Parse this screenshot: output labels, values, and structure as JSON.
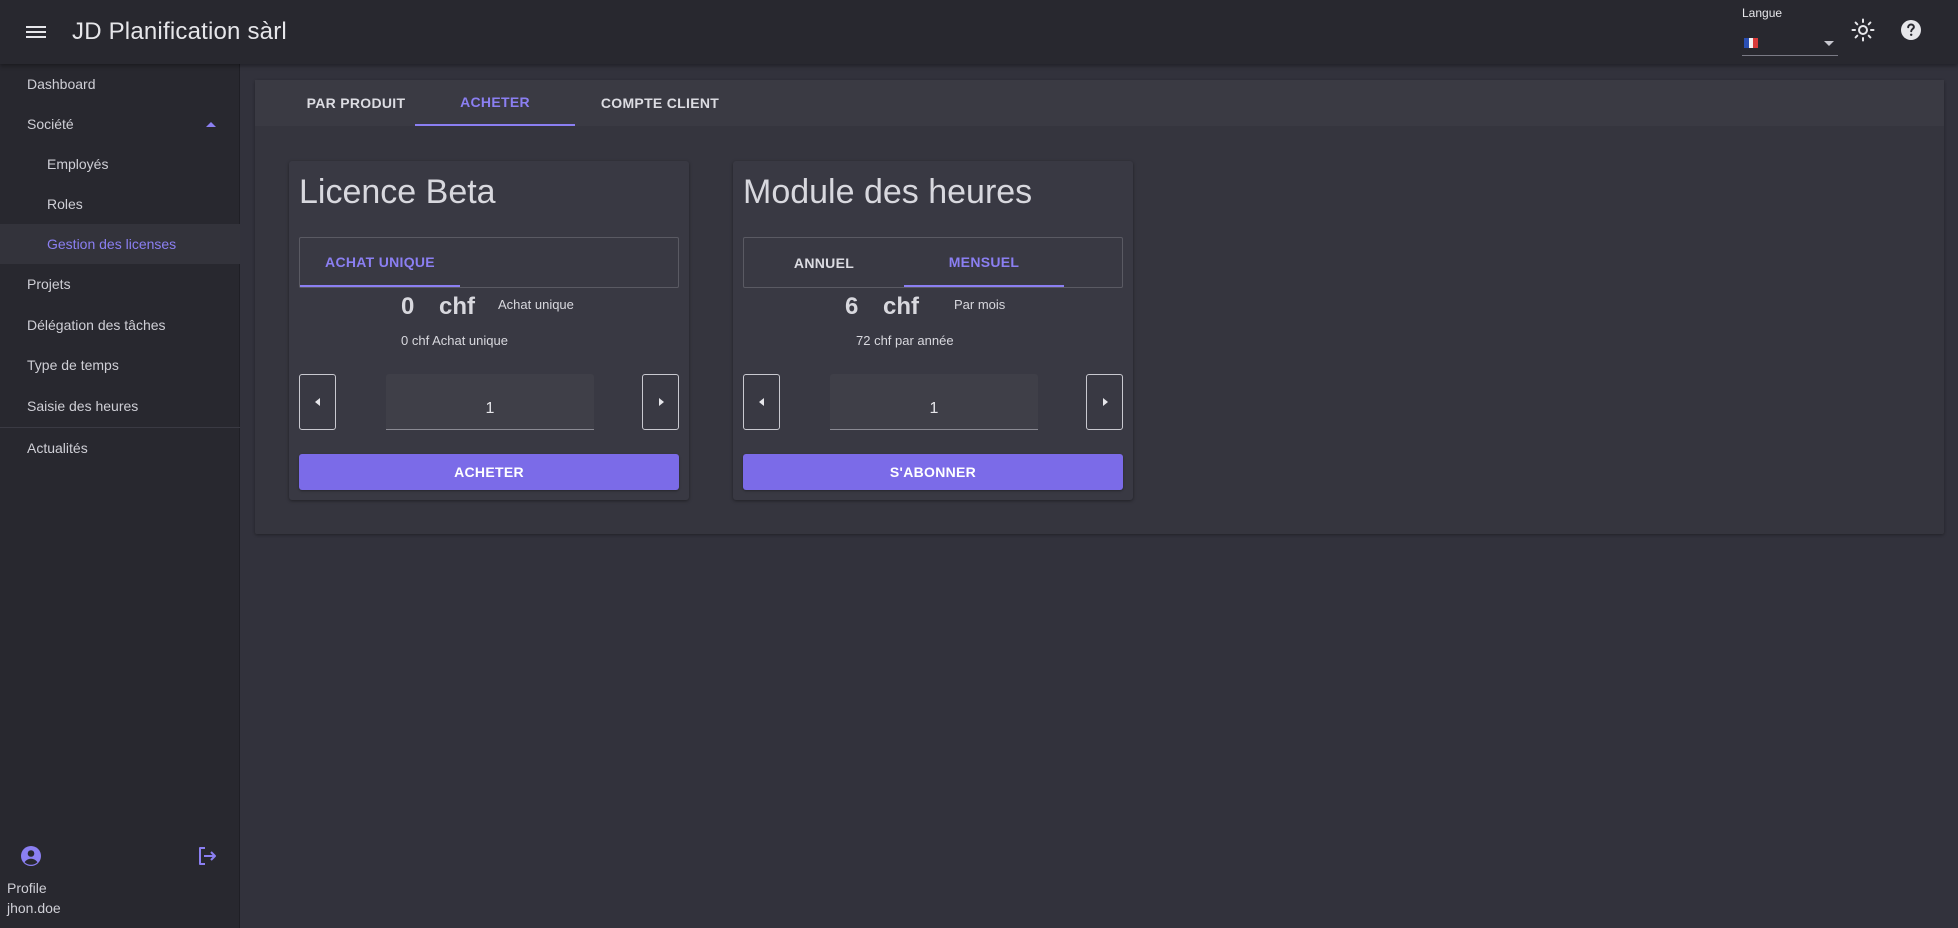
{
  "app": {
    "title": "JD Planification sàrl"
  },
  "header": {
    "language_label": "Langue",
    "language_value": "fr",
    "icons": [
      "menu-icon",
      "flag-fr-icon",
      "chevron-down-icon",
      "sun-icon",
      "help-icon"
    ]
  },
  "sidebar": {
    "items": [
      {
        "label": "Dashboard"
      },
      {
        "label": "Société"
      },
      {
        "label": "Employés"
      },
      {
        "label": "Roles"
      },
      {
        "label": "Gestion des licenses"
      },
      {
        "label": "Projets"
      },
      {
        "label": "Délégation des tâches"
      },
      {
        "label": "Type de temps"
      },
      {
        "label": "Saisie des heures"
      },
      {
        "label": "Actualités"
      }
    ],
    "profile_label": "Profile",
    "username": "jhon.doe"
  },
  "main": {
    "tabs": [
      {
        "label": "PAR PRODUIT"
      },
      {
        "label": "ACHETER"
      },
      {
        "label": "COMPTE CLIENT"
      }
    ],
    "active_tab": "ACHETER",
    "cards": [
      {
        "title": "Licence Beta",
        "subtabs": [
          {
            "label": "ACHAT UNIQUE"
          }
        ],
        "active_subtab": "ACHAT UNIQUE",
        "price": "0",
        "currency": "chf",
        "period": "Achat unique",
        "summary": "0 chf Achat unique",
        "quantity": "1",
        "cta": "ACHETER"
      },
      {
        "title": "Module des heures",
        "subtabs": [
          {
            "label": "ANNUEL"
          },
          {
            "label": "MENSUEL"
          }
        ],
        "active_subtab": "MENSUEL",
        "price": "6",
        "currency": "chf",
        "period": "Par mois",
        "summary": "72 chf par année",
        "quantity": "1",
        "cta": "S'ABONNER"
      }
    ]
  },
  "colors": {
    "accent": "#8b7ff2",
    "button": "#7b6be8",
    "background": "#32323c",
    "surface": "#28282f"
  }
}
